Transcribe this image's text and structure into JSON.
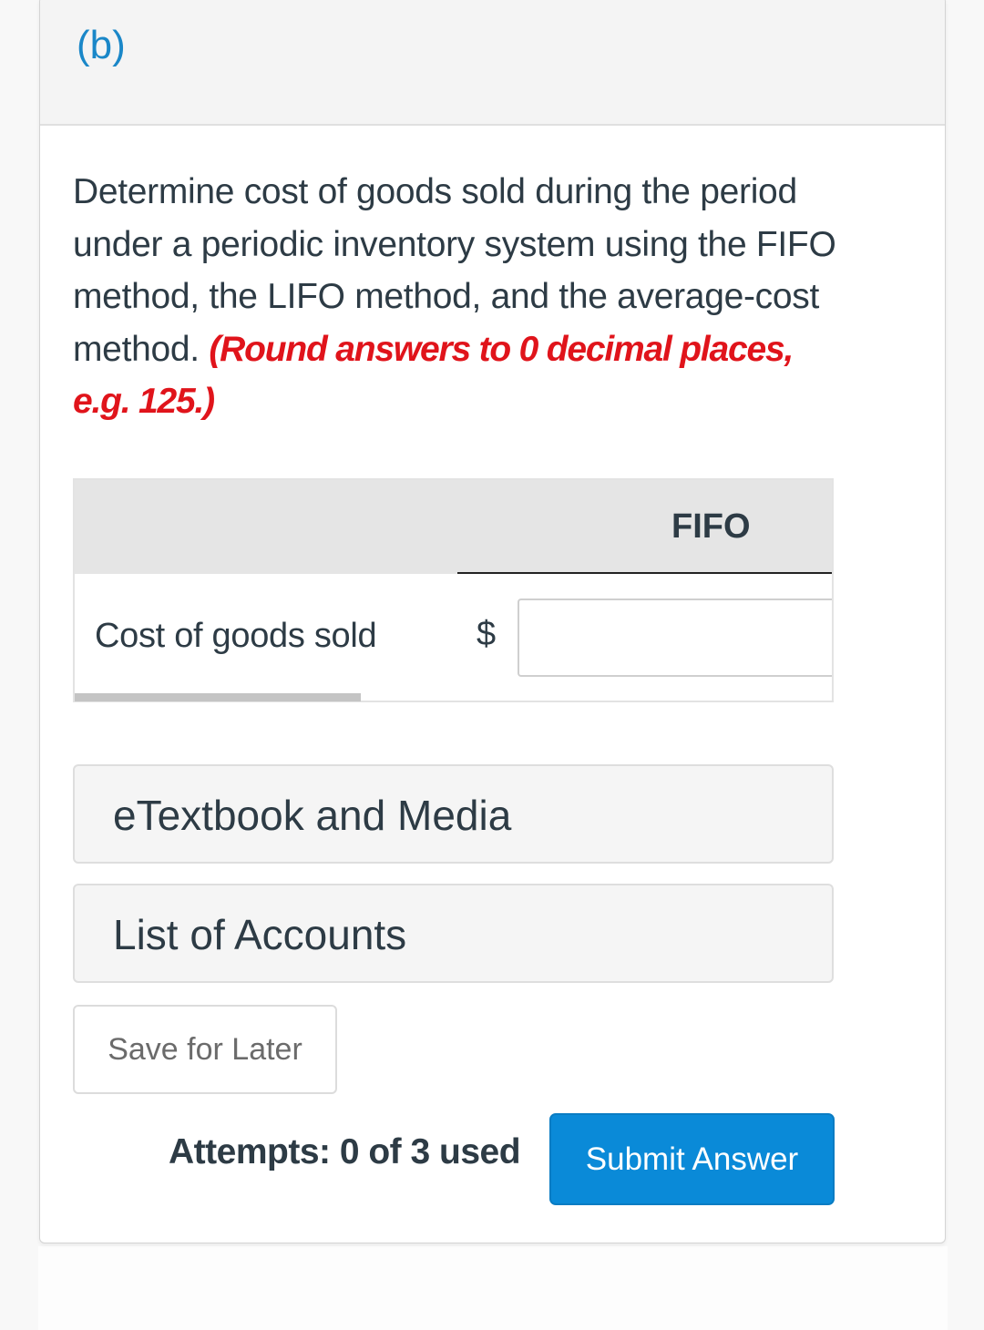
{
  "part": {
    "label": "(b)"
  },
  "question": {
    "text": "Determine cost of goods sold during the period under a periodic inventory system using the FIFO method, the LIFO method, and the average-cost method.",
    "note": "(Round answers to 0 decimal places, e.g. 125.)"
  },
  "table": {
    "columns": [
      "",
      "FIFO"
    ],
    "rows": [
      {
        "label": "Cost of goods sold",
        "currency": "$",
        "value": "",
        "placeholder": ""
      }
    ]
  },
  "resources": {
    "etextbook_label": "eTextbook and Media",
    "accounts_label": "List of Accounts"
  },
  "actions": {
    "save_label": "Save for Later",
    "attempts_text": "Attempts: 0 of 3 used",
    "submit_label": "Submit Answer"
  },
  "colors": {
    "accent": "#0a8ad8",
    "part_label": "#1a87c8",
    "note": "#e0141b"
  }
}
